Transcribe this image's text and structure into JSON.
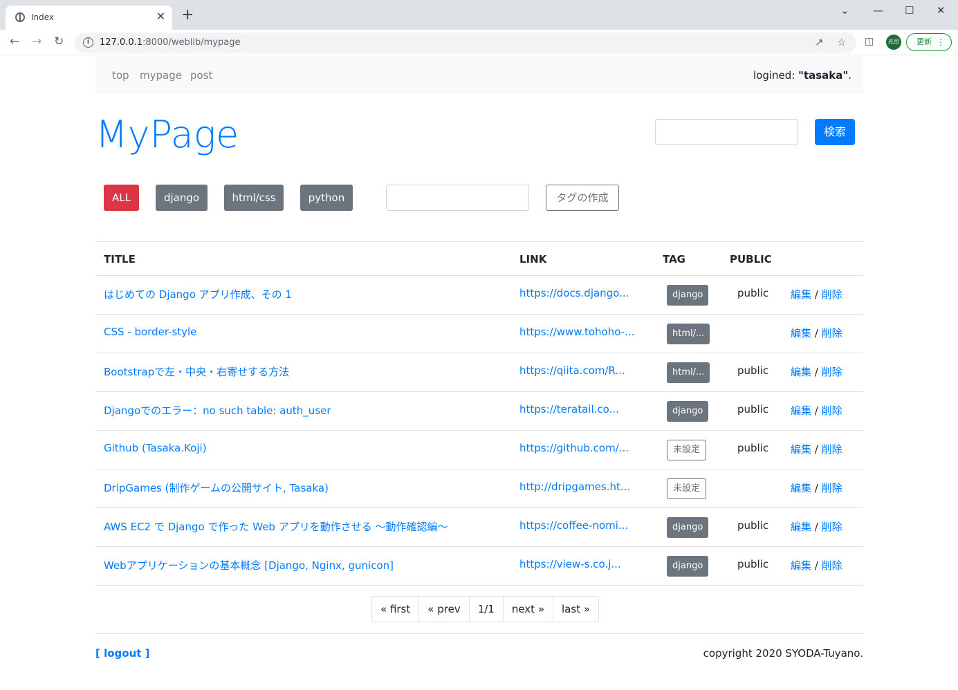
{
  "browser": {
    "tab_title": "Index",
    "tab_close": "✕",
    "new_tab": "+",
    "url_host": "127.0.0.1",
    "url_path": ":8000/weblib/mypage",
    "profile_label": "光司",
    "update_label": "更新",
    "win_min": "—",
    "win_max": "☐",
    "win_close": "✕",
    "collapse": "⌄"
  },
  "navbar": {
    "links": [
      "top",
      "mypage",
      "post"
    ],
    "logined_prefix": "logined: ",
    "logined_user": "\"tasaka\"",
    "logined_suffix": "."
  },
  "page": {
    "title": "MyPage",
    "search_button": "検索",
    "create_tag_button": "タグの作成"
  },
  "tags": [
    {
      "label": "ALL",
      "color": "#dc3545"
    },
    {
      "label": "django",
      "color": "#6c757d"
    },
    {
      "label": "html/css",
      "color": "#6c757d"
    },
    {
      "label": "python",
      "color": "#6c757d"
    }
  ],
  "table": {
    "headers": {
      "title": "TITLE",
      "link": "LINK",
      "tag": "TAG",
      "public": "PUBLIC"
    },
    "edit_label": "編集",
    "separator": " / ",
    "delete_label": "削除",
    "rows": [
      {
        "title": "はじめての Django アプリ作成、その 1",
        "link": "https://docs.django...",
        "tag": "django",
        "tag_style": "dark",
        "public": "public"
      },
      {
        "title": "CSS - border-style",
        "link": "https://www.tohoho-...",
        "tag": "html/...",
        "tag_style": "dark",
        "public": ""
      },
      {
        "title": "Bootstrapで左・中央・右寄せする方法",
        "link": "https://qiita.com/R...",
        "tag": "html/...",
        "tag_style": "dark",
        "public": "public"
      },
      {
        "title": "Djangoでのエラー：no such table: auth_user",
        "link": "https://teratail.co...",
        "tag": "django",
        "tag_style": "dark",
        "public": "public"
      },
      {
        "title": "Github (Tasaka.Koji)",
        "link": "https://github.com/...",
        "tag": "未設定",
        "tag_style": "outline",
        "public": "public"
      },
      {
        "title": "DripGames (制作ゲームの公開サイト, Tasaka)",
        "link": "http://dripgames.ht...",
        "tag": "未設定",
        "tag_style": "outline",
        "public": ""
      },
      {
        "title": "AWS EC2 で Django で作った Web アプリを動作させる 〜動作確認編〜",
        "link": "https://coffee-nomi...",
        "tag": "django",
        "tag_style": "dark",
        "public": "public"
      },
      {
        "title": "Webアプリケーションの基本概念 [Django, Nginx, gunicon]",
        "link": "https://view-s.co.j...",
        "tag": "django",
        "tag_style": "dark",
        "public": "public"
      }
    ]
  },
  "pagination": [
    "« first",
    "« prev",
    "1/1",
    "next »",
    "last »"
  ],
  "footer": {
    "logout": "[ logout ]",
    "copyright": "copyright 2020 SYODA-Tuyano."
  }
}
